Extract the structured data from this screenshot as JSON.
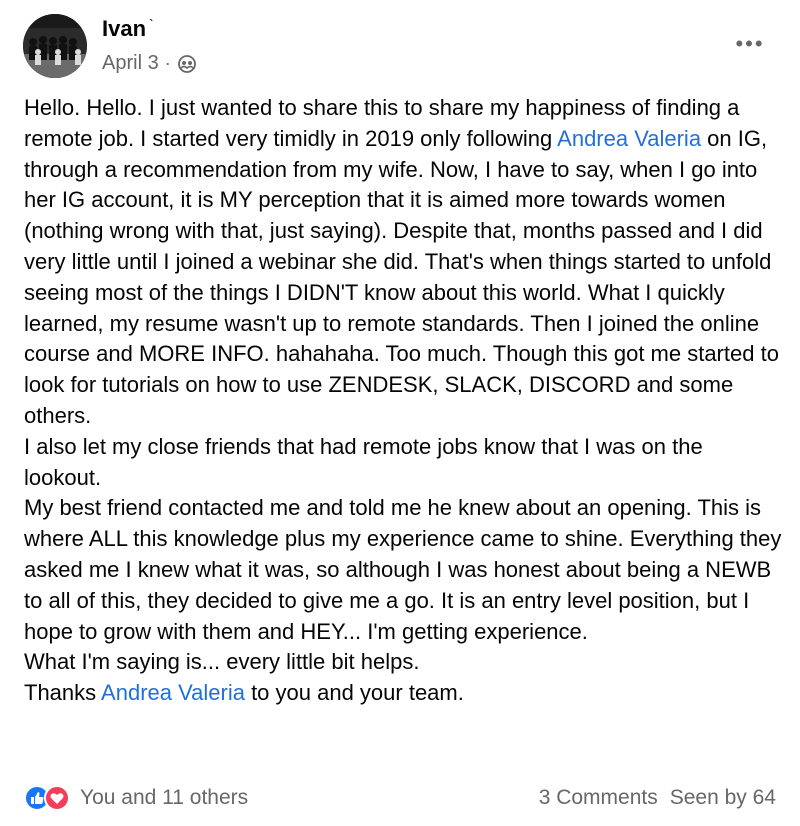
{
  "post": {
    "author": "Ivan",
    "author_suffix": "`",
    "date": "April 3",
    "separator": "·",
    "privacy_icon": "friends-icon",
    "more_icon": "•••",
    "paragraphs": [
      {
        "before": "Hello. Hello. I just wanted to share this to share my happiness of finding a remote job. I started very timidly in 2019 only following ",
        "mention": "Andrea Valeria",
        "after": " on IG, through a recommendation from my wife. Now, I have to say, when I go into her IG account, it is MY perception that it is aimed more towards women (nothing wrong with that, just saying). Despite that, months passed and I did very little until I joined a webinar she did. That's when things started to unfold seeing most of the things I DIDN'T know about this world. What I quickly learned, my resume wasn't up to remote standards. Then I joined the online course and MORE INFO. hahahaha. Too much. Though this got me started to look for tutorials on how to use ZENDESK, SLACK, DISCORD and some others."
      },
      {
        "text": "I also let my close friends that had remote jobs know that I was on the lookout."
      },
      {
        "text": "My best friend contacted me and told me he knew about an opening. This is where ALL this knowledge plus my experience came to shine. Everything they asked me I knew what it was, so although I was honest about being a NEWB to all of this, they decided to give me a go. It is an entry level position, but I hope to grow with them and HEY... I'm getting experience."
      },
      {
        "text": "What I'm saying is... every little bit helps."
      },
      {
        "before": "Thanks ",
        "mention": "Andrea Valeria",
        "after": " to you and your team."
      }
    ],
    "footer": {
      "reaction_icons": [
        "like-icon",
        "love-icon"
      ],
      "reactions_label": "You and 11 others",
      "comments_label": "3 Comments",
      "seen_label": "Seen by 64"
    },
    "colors": {
      "link": "#216fdb",
      "secondary_text": "#65676b",
      "like": "#1877f2",
      "love": "#f33e58"
    }
  }
}
